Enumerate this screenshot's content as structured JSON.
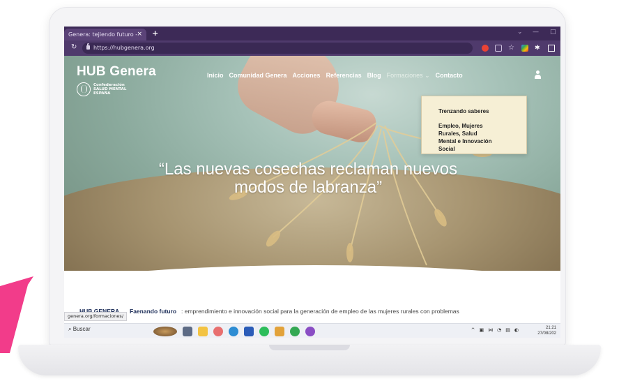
{
  "browser": {
    "tab_title": "Genera: tejiendo futuro - ",
    "new_tab_symbol": "+",
    "tab_close_symbol": "×",
    "url": "https://hubgenera.org",
    "window_controls": [
      "⌄",
      "—",
      "□"
    ],
    "extensions": [
      "google-icon",
      "share-icon",
      "star-icon",
      "color-extension-icon",
      "puzzle-icon",
      "sidebar-icon"
    ]
  },
  "site": {
    "logo": "HUB Genera",
    "partner_logo_lines": [
      "Confederación",
      "SALUD MENTAL",
      "ESPAÑA"
    ],
    "nav": [
      "Inicio",
      "Comunidad Genera",
      "Acciones",
      "Referencias",
      "Blog",
      "Formaciones ⌄",
      "Contacto"
    ],
    "dropdown": {
      "items": [
        "Trenzando saberes",
        "Empleo, Mujeres",
        "Rurales, Salud",
        "Mental e Innovación",
        "Social"
      ]
    },
    "hero_quote_line1": "“Las nuevas cosechas reclaman nuevos",
    "hero_quote_line2": "modos de labranza”",
    "body_brand": "HUB GENERA",
    "body_title": "Faenando futuro",
    "body_text": ": emprendimiento e innovación social para la generación de empleo de las mujeres rurales con problemas"
  },
  "status_link": "genera.org/formaciones/",
  "taskbar": {
    "search_label": "Buscar",
    "search_icon": "search-icon",
    "tray_symbols": [
      "^",
      "▣",
      "⋈",
      "◔",
      "▤",
      "◐"
    ],
    "clock_time": "21:21",
    "clock_date": "27/08/202"
  },
  "colors": {
    "browser_chrome": "#3d2a57",
    "dropdown_bg": "#f6efd5",
    "hero_green": "#8aa99c",
    "brand_text": "#1c2d58"
  }
}
